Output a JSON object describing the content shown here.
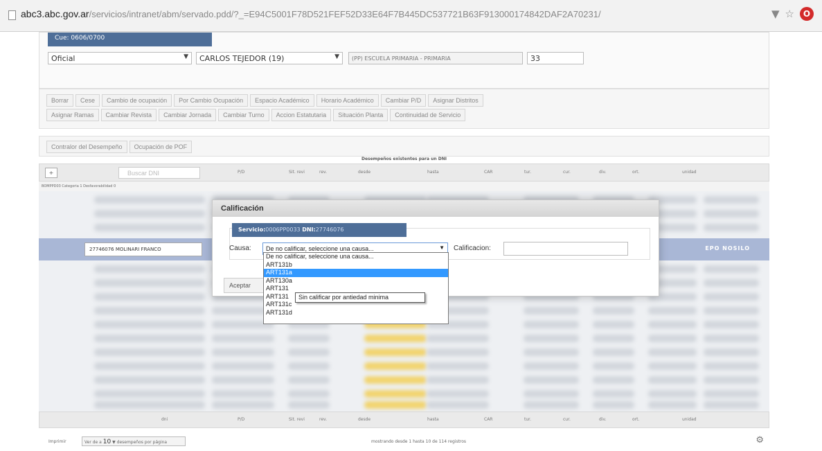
{
  "browser": {
    "url_host": "abc3.abc.gov.ar",
    "url_rest": "/servicios/intranet/abm/servado.pdd/?_=E94C5001F78D521FEF52D33E64F7B445DC537721B63F913000174842DAF2A70231/",
    "opera_label": "O"
  },
  "filters": {
    "cue": "Cue: 0606/0700",
    "oficial": "Oficial",
    "distrito": "CARLOS TEJEDOR (19)",
    "escuela": "(PP) ESCUELA PRIMARIA - PRIMARIA",
    "numero": "33"
  },
  "actions_row1": [
    "Borrar",
    "Cese",
    "Cambio de ocupación",
    "Por Cambio Ocupación",
    "Espacio Académico",
    "Horario Académico",
    "Cambiar P/D",
    "Asignar Distritos"
  ],
  "actions_row2": [
    "Asignar Ramas",
    "Cambiar Revista",
    "Cambiar Jornada",
    "Cambiar Turno",
    "Accion Estatutaria",
    "Situación Planta",
    "Continuidad de Servicio"
  ],
  "actions_row3": [
    "Contralor del Desempeño",
    "Ocupación de POF"
  ],
  "table": {
    "caption": "Desempeños existentes para un DNI",
    "expand": "+",
    "search_placeholder": "Buscar DNI",
    "headers": [
      "P/D",
      "Sit. revi",
      "rev.",
      "desde",
      "hasta",
      "CAR",
      "tur.",
      "cur.",
      "div.",
      "ort.",
      "unidad"
    ],
    "footer_headers": [
      "dni",
      "P/D",
      "Sit. revi",
      "rev.",
      "desde",
      "hasta",
      "CAR",
      "tur.",
      "cur.",
      "div.",
      "ort.",
      "unidad"
    ],
    "subheader": "BOMPPD03 Categoria 1 Desfavorabilidad 0",
    "selected_row_name": "27746076 MOLINARI FRANCO",
    "selected_row_right": "EPO NOSILO"
  },
  "pager": {
    "label": "Imprimir",
    "prefix": "Ver de a",
    "per_page": "10",
    "suffix": "desempeños por página",
    "info": "mostrando desde 1 hasta 10 de 114 registros"
  },
  "modal": {
    "title": "Calificación",
    "service_label": "Servicio:",
    "service_value": "0006PP0033",
    "dni_label": "DNI:",
    "dni_value": "27746076",
    "causa_label": "Causa:",
    "causa_value": "De no calificar, seleccione una causa...",
    "calificacion_label": "Calificacion:",
    "aceptar": "Aceptar"
  },
  "dropdown": {
    "options": [
      "De no calificar, seleccione una causa...",
      "ART131b",
      "ART131a",
      "ART130a",
      "ART131",
      "ART131",
      "ART131c",
      "ART131d"
    ],
    "highlighted_index": 2,
    "tooltip": "Sin calificar por antiedad minima"
  }
}
